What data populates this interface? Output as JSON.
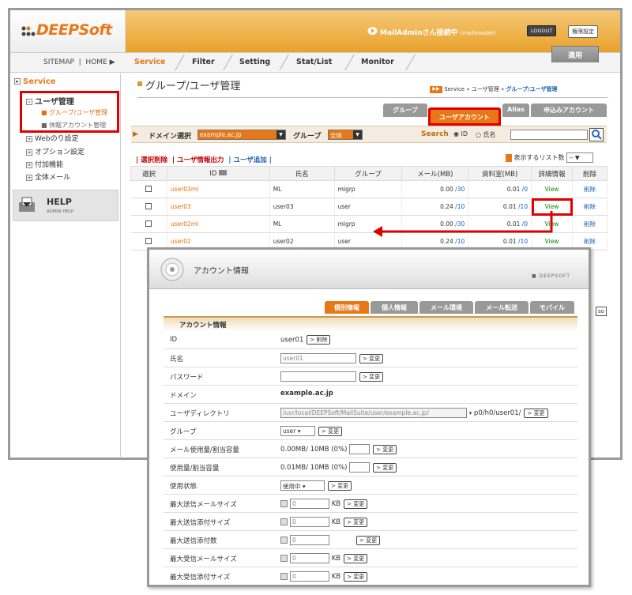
{
  "header": {
    "logo": "DEEPSoft",
    "connection": "MailAdminさん接続中",
    "connection_user": "(mailmaster)",
    "logout_label": "LOGOUT",
    "perm_label": "権限設定"
  },
  "nav": {
    "sitemap": "SITEMAP",
    "home": "HOME",
    "tabs": [
      "Service",
      "Filter",
      "Setting",
      "Stat/List",
      "Monitor"
    ],
    "apply": "適用"
  },
  "sidebar": {
    "section": "Service",
    "items": [
      "ユーザ管理",
      "グループ/ユーザ管理",
      "休眠アカウント管理",
      "Webのり設定",
      "オプション設定",
      "付加機能",
      "全体メール"
    ],
    "help": "HELP",
    "help_sub": "ADMIN HELP"
  },
  "page": {
    "title": "グループ/ユーザ管理",
    "breadcrumb": [
      "Service",
      "ユーザ管理",
      "グループ/ユーザ管理"
    ],
    "tabs": [
      "グループ",
      "ユーザアカウント",
      "Alias",
      "申込みアカウント"
    ]
  },
  "filter": {
    "domain_label": "ドメイン選択",
    "domain_value": "example.ac.jp",
    "group_label": "グループ",
    "group_value": "全体",
    "search_label": "Search",
    "opt_id": "ID",
    "opt_name": "氏名"
  },
  "actions": {
    "delete_selected": "選択削除",
    "export": "ユーザ情報出力",
    "add_user": "ユーザ追加",
    "list_count_label": "表示するリスト数",
    "list_count_value": "--"
  },
  "table": {
    "headers": [
      "選択",
      "ID",
      "氏名",
      "グループ",
      "メール(MB)",
      "資料室(MB)",
      "詳細情報",
      "削除"
    ],
    "rows": [
      {
        "id": "user03ml",
        "name": "ML",
        "group": "mlgrp",
        "mail_used": "0.00",
        "mail_quota": "/30",
        "data_used": "0.01",
        "data_quota": "/0",
        "view": "View",
        "del": "削除"
      },
      {
        "id": "user03",
        "name": "user03",
        "group": "user",
        "mail_used": "0.24",
        "mail_quota": "/10",
        "data_used": "0.01",
        "data_quota": "/10",
        "view": "View",
        "del": "削除"
      },
      {
        "id": "user02ml",
        "name": "ML",
        "group": "mlgrp",
        "mail_used": "0.00",
        "mail_quota": "/30",
        "data_used": "0.01",
        "data_quota": "/0",
        "view": "View",
        "del": "削除"
      },
      {
        "id": "user02",
        "name": "user02",
        "group": "user",
        "mail_used": "0.24",
        "mail_quota": "/10",
        "data_used": "0.01",
        "data_quota": "/10",
        "view": "View",
        "del": "削除"
      }
    ]
  },
  "popup": {
    "title": "アカウント情報",
    "brand": "DEEPSOFT",
    "tabs": [
      "個別情報",
      "個人情報",
      "メール環境",
      "メール転送",
      "モバイル"
    ],
    "section": "アカウント情報",
    "btn_change": "変更",
    "btn_delete": "削除",
    "kb": "KB",
    "fields": [
      {
        "label": "ID",
        "value": "user01"
      },
      {
        "label": "氏名",
        "value": "user01"
      },
      {
        "label": "パスワード",
        "value": ""
      },
      {
        "label": "ドメイン",
        "value": "example.ac.jp"
      },
      {
        "label": "ユーザディレクトリ",
        "value": "/usr/local/DEEPSoft/MailSuite/user/example.ac.jp/",
        "suffix": "p0/h0/user01/"
      },
      {
        "label": "グループ",
        "value": "user"
      },
      {
        "label": "メール使用量/割当容量",
        "value": "0.00MB/ 10MB (0%)"
      },
      {
        "label": "使用量/割当容量",
        "value": "0.01MB/ 10MB (0%)"
      },
      {
        "label": "使用状態",
        "value": "使用中"
      },
      {
        "label": "最大送信メールサイズ",
        "value": "0"
      },
      {
        "label": "最大送信添付サイズ",
        "value": "0"
      },
      {
        "label": "最大送信添付数",
        "value": "0"
      },
      {
        "label": "最大受信メールサイズ",
        "value": "0"
      },
      {
        "label": "最大受信添付サイズ",
        "value": "0"
      }
    ]
  },
  "overflow_btn": "so",
  "colors": {
    "accent": "#e87817",
    "highlight": "#e10000"
  }
}
